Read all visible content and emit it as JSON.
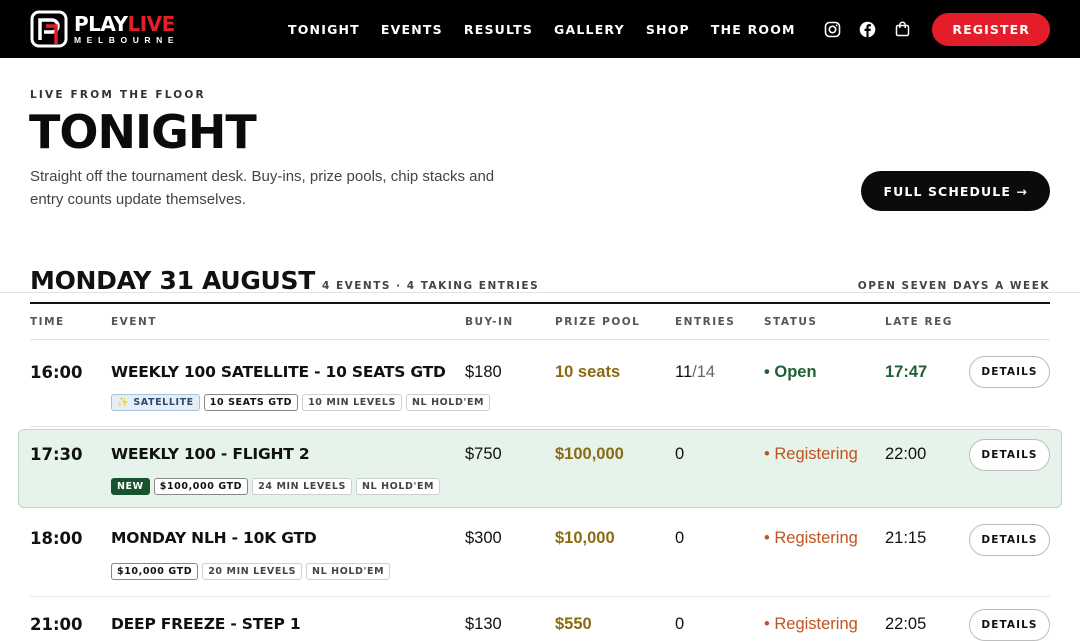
{
  "brand": {
    "name_white": "PLAY",
    "name_red": "LIVE",
    "sub": "MELBOURNE",
    "accent": "#e31e2a"
  },
  "nav": {
    "items": [
      "TONIGHT",
      "EVENTS",
      "RESULTS",
      "GALLERY",
      "SHOP",
      "THE ROOM"
    ],
    "icons": [
      "instagram-icon",
      "facebook-icon",
      "cart-icon"
    ],
    "register": "REGISTER"
  },
  "hero": {
    "eyebrow": "LIVE FROM THE FLOOR",
    "title": "TONIGHT",
    "desc_line1": "Straight off the tournament desk. Buy-ins, prize pools, chip stacks and",
    "desc_line2": "entry counts update themselves.",
    "full_schedule": "FULL SCHEDULE →"
  },
  "day": {
    "title": "MONDAY 31 AUGUST",
    "meta": "4 EVENTS · 4 TAKING ENTRIES",
    "open": "OPEN SEVEN DAYS A WEEK"
  },
  "columns": [
    "TIME",
    "EVENT",
    "BUY-IN",
    "PRIZE POOL",
    "ENTRIES",
    "STATUS",
    "LATE REG"
  ],
  "events": [
    {
      "time": "16:00",
      "name": "WEEKLY 100 SATELLITE - 10 SEATS GTD",
      "buyin": "$180",
      "prize": "10 seats",
      "entries": "11",
      "entries_max": "/14",
      "status": "• Open",
      "late": "17:47",
      "details": "DETAILS",
      "tags": [
        "✨ SATELLITE",
        "10 SEATS GTD",
        "10 MIN LEVELS",
        "NL HOLD'EM"
      ]
    },
    {
      "time": "17:30",
      "name": "WEEKLY 100 - FLIGHT 2",
      "buyin": "$750",
      "prize": "$100,000",
      "entries": "0",
      "entries_max": "",
      "status": "• Registering",
      "late": "22:00",
      "details": "DETAILS",
      "tags": [
        "NEW",
        "$100,000 GTD",
        "24 MIN LEVELS",
        "NL HOLD'EM"
      ]
    },
    {
      "time": "18:00",
      "name": "MONDAY NLH - 10K GTD",
      "buyin": "$300",
      "prize": "$10,000",
      "entries": "0",
      "entries_max": "",
      "status": "• Registering",
      "late": "21:15",
      "details": "DETAILS",
      "tags": [
        "$10,000 GTD",
        "20 MIN LEVELS",
        "NL HOLD'EM"
      ]
    },
    {
      "time": "21:00",
      "name": "DEEP FREEZE - STEP 1",
      "buyin": "$130",
      "prize": "$550",
      "entries": "0",
      "entries_max": "",
      "status": "• Registering",
      "late": "22:05",
      "details": "DETAILS",
      "tags": []
    }
  ]
}
